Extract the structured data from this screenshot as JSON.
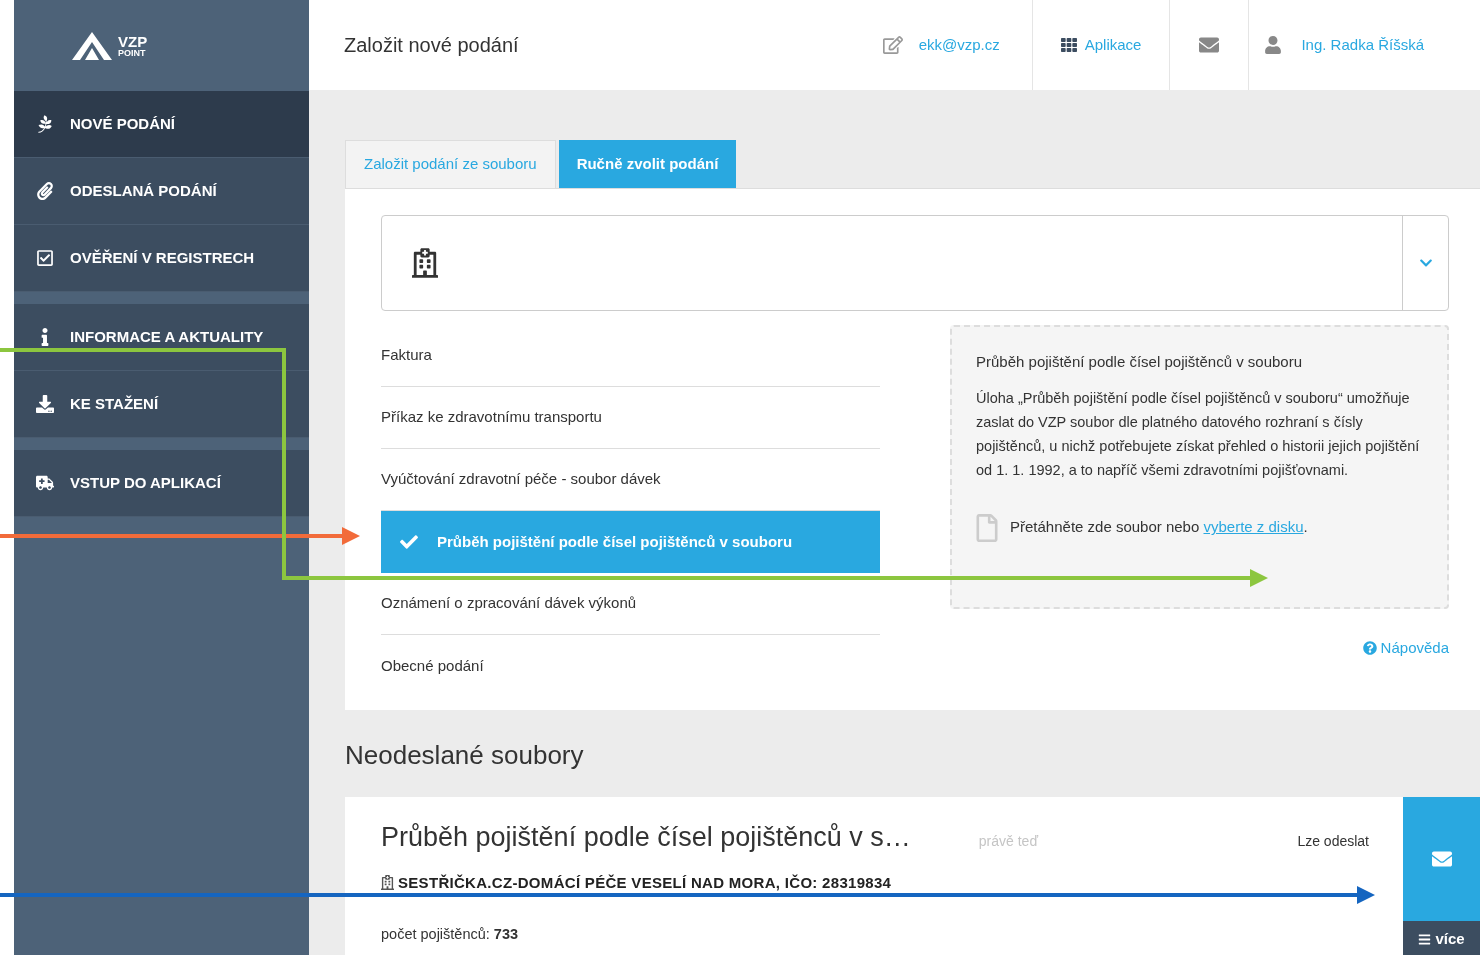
{
  "logo": {
    "name": "VZP",
    "sub": "POINT"
  },
  "header": {
    "title": "Založit nové podání",
    "email": "ekk@vzp.cz",
    "apps": "Aplikace",
    "user": "Ing. Radka Říšská"
  },
  "sidebar": {
    "groups": [
      {
        "items": [
          {
            "label": "NOVÉ PODÁNÍ",
            "selected": true
          },
          {
            "label": "ODESLANÁ PODÁNÍ",
            "selected": false
          },
          {
            "label": "OVĚŘENÍ V REGISTRECH",
            "selected": false
          }
        ]
      },
      {
        "items": [
          {
            "label": "INFORMACE A AKTUALITY",
            "selected": false
          },
          {
            "label": "KE STAŽENÍ",
            "selected": false
          }
        ]
      },
      {
        "items": [
          {
            "label": "VSTUP DO APLIKACÍ",
            "selected": false
          }
        ]
      }
    ]
  },
  "tabs": [
    {
      "label": "Založit podání ze souboru",
      "selected": false
    },
    {
      "label": "Ručně zvolit podání",
      "selected": true
    }
  ],
  "submission_types": [
    {
      "label": "Faktura",
      "selected": false
    },
    {
      "label": "Příkaz ke zdravotnímu transportu",
      "selected": false
    },
    {
      "label": "Vyúčtování zdravotní péče - soubor dávek",
      "selected": false
    },
    {
      "label": "Průběh pojištění podle čísel pojištěnců v souboru",
      "selected": true
    },
    {
      "label": "Oznámení o zpracování dávek výkonů",
      "selected": false
    },
    {
      "label": "Obecné podání",
      "selected": false
    }
  ],
  "info": {
    "title": "Průběh pojištění podle čísel pojištěnců v souboru",
    "text": "Úloha „Průběh pojištění podle čísel pojištěnců v souboru“ umožňuje zaslat do VZP soubor dle platného datového rozhraní s čísly pojištěnců, u nichž potřebujete získat přehled o historii jejich pojištění od 1. 1. 1992, a to napříč všemi zdravotními pojišťovnami.",
    "drop_text": "Přetáhněte zde soubor nebo",
    "drop_link": "vyberte z disku",
    "drop_suffix": "."
  },
  "help": "Nápověda",
  "unsent": {
    "heading": "Neodeslané soubory",
    "files": [
      {
        "title": "Průběh pojištění podle čísel pojištěnců v s…",
        "time": "právě teď",
        "status": "Lze odeslat",
        "org": "SESTŘIČKA.CZ-DOMÁCÍ PÉČE VESELÍ NAD MORA, IČO: 28319834",
        "count": "počet pojištěnců: **733**",
        "more": "více"
      }
    ]
  },
  "annotations": [
    {
      "color": "#f26b3a"
    },
    {
      "color": "#8cc63f"
    },
    {
      "color": "#1565c0"
    }
  ]
}
